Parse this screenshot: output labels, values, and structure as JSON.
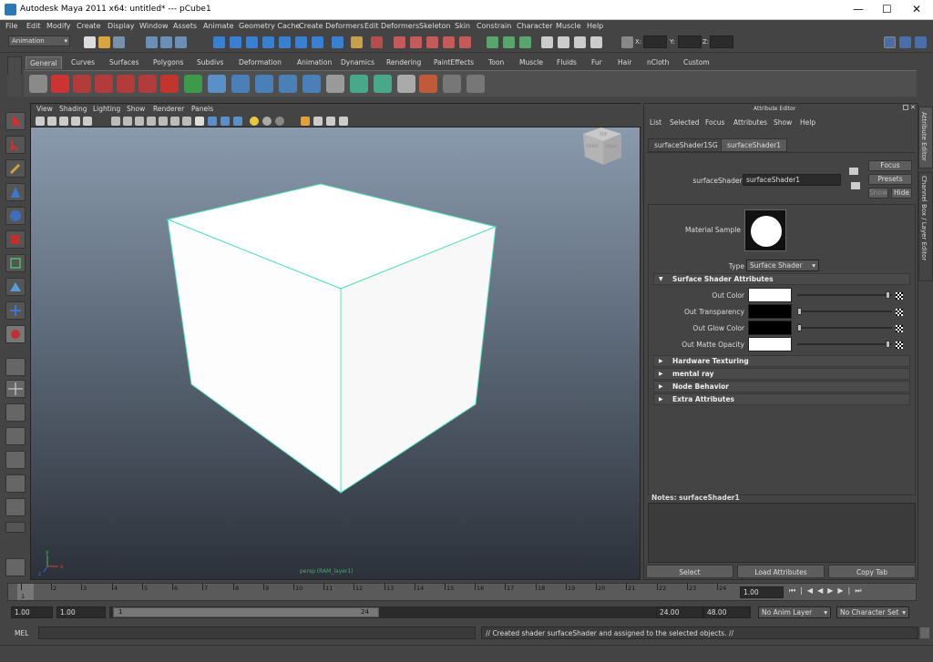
{
  "window": {
    "title": "Autodesk Maya 2011 x64: untitled*   ---   pCube1",
    "minimize": "—",
    "maximize": "☐",
    "close": "✕"
  },
  "menu": [
    "File",
    "Edit",
    "Modify",
    "Create",
    "Display",
    "Window",
    "Assets",
    "Animate",
    "Geometry Cache",
    "Create Deformers",
    "Edit Deformers",
    "Skeleton",
    "Skin",
    "Constrain",
    "Character",
    "Muscle",
    "Help"
  ],
  "status": {
    "mode": "Animation",
    "x_label": "X:",
    "y_label": "Y:",
    "z_label": "Z:"
  },
  "shelf_tabs": [
    "General",
    "Curves",
    "Surfaces",
    "Polygons",
    "Subdivs",
    "Deformation",
    "Animation",
    "Dynamics",
    "Rendering",
    "PaintEffects",
    "Toon",
    "Muscle",
    "Fluids",
    "Fur",
    "Hair",
    "nCloth",
    "Custom"
  ],
  "viewport": {
    "menu": [
      "View",
      "Shading",
      "Lighting",
      "Show",
      "Renderer",
      "Panels"
    ],
    "camera_label": "persp (RAM_layer1)",
    "viewcube": {
      "top": "TOP",
      "front": "FRONT",
      "right": "RIGHT"
    },
    "axis": {
      "x": "x",
      "y": "y",
      "z": "z"
    }
  },
  "attribute_editor": {
    "title": "Attribute Editor",
    "menu": [
      "List",
      "Selected",
      "Focus",
      "Attributes",
      "Show",
      "Help"
    ],
    "tabs": [
      "surfaceShader1SG",
      "surfaceShader1"
    ],
    "node_label": "surfaceShader:",
    "node_value": "surfaceShader1",
    "buttons": {
      "focus": "Focus",
      "presets": "Presets",
      "show": "Show",
      "hide": "Hide"
    },
    "material_sample": "Material Sample",
    "type_label": "Type",
    "type_value": "Surface Shader",
    "section_main": "Surface Shader Attributes",
    "attrs": [
      {
        "label": "Out Color",
        "color": "#ffffff",
        "level": 0.97
      },
      {
        "label": "Out Transparency",
        "color": "#000000",
        "level": 0.0
      },
      {
        "label": "Out Glow Color",
        "color": "#000000",
        "level": 0.0
      },
      {
        "label": "Out Matte Opacity",
        "color": "#ffffff",
        "level": 0.97
      }
    ],
    "sections": [
      "Hardware Texturing",
      "mental ray",
      "Node Behavior",
      "Extra Attributes"
    ],
    "notes_label": "Notes:  surfaceShader1",
    "bottom_buttons": [
      "Select",
      "Load Attributes",
      "Copy Tab"
    ]
  },
  "right_tabs": [
    "Attribute Editor",
    "Channel Box / Layer Editor"
  ],
  "time": {
    "ticks": [
      "1",
      "2",
      "3",
      "4",
      "5",
      "6",
      "7",
      "8",
      "9",
      "10",
      "11",
      "12",
      "13",
      "14",
      "15",
      "16",
      "17",
      "18",
      "19",
      "20",
      "21",
      "22",
      "23",
      "24"
    ],
    "current": "1.00",
    "current_frame": "1"
  },
  "range": {
    "start": "1.00",
    "start2": "1.00",
    "slider_start": "1",
    "slider_end": "24",
    "end": "24.00",
    "end2": "48.00",
    "anim_layer": "No Anim Layer",
    "char_set": "No Character Set"
  },
  "command": {
    "label": "MEL",
    "result": "// Created shader surfaceShader and assigned to the selected objects. //"
  }
}
